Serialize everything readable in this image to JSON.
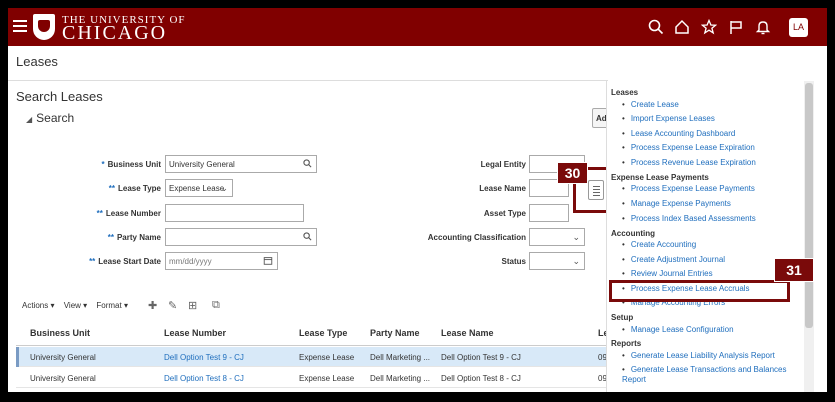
{
  "header": {
    "logo_top": "THE UNIVERSITY OF",
    "logo_main": "CHICAGO",
    "icons": [
      "search-icon",
      "home-icon",
      "star-icon",
      "flag-icon",
      "bell-icon"
    ],
    "avatar": "LA",
    "color": "#800000"
  },
  "page_title": "Leases",
  "search": {
    "title": "Search Leases",
    "toggle_label": "Search",
    "advanced_label": "Ad",
    "fields": {
      "business_unit": {
        "label": "Business Unit",
        "req": "*",
        "value": "University General"
      },
      "lease_type": {
        "label": "Lease Type",
        "req": "**",
        "value": "Expense Lease"
      },
      "lease_number": {
        "label": "Lease Number",
        "req": "**",
        "value": ""
      },
      "party_name": {
        "label": "Party Name",
        "req": "**",
        "value": ""
      },
      "lease_start_date": {
        "label": "Lease Start Date",
        "req": "**",
        "placeholder": "mm/dd/yyyy"
      },
      "legal_entity": {
        "label": "Legal Entity"
      },
      "lease_name": {
        "label": "Lease Name"
      },
      "asset_type": {
        "label": "Asset Type"
      },
      "accounting_classification": {
        "label": "Accounting Classification"
      },
      "status": {
        "label": "Status"
      }
    }
  },
  "toolbar": {
    "actions": "Actions ▾",
    "view": "View ▾",
    "format": "Format ▾"
  },
  "table": {
    "columns": [
      "Business Unit",
      "Lease Number",
      "Lease Type",
      "Party Name",
      "Lease Name",
      "Le"
    ],
    "rows": [
      {
        "bu": "University General",
        "num": "Dell Option Test 9 - CJ",
        "type": "Expense Lease",
        "party": "Dell Marketing ...",
        "name": "Dell Option Test 9 - CJ",
        "le": "09"
      },
      {
        "bu": "University General",
        "num": "Dell Option Test 8 - CJ",
        "type": "Expense Lease",
        "party": "Dell Marketing ...",
        "name": "Dell Option Test 8 - CJ",
        "le": "09"
      }
    ]
  },
  "tasks": {
    "leases": {
      "title": "Leases",
      "items": [
        "Create Lease",
        "Import Expense Leases",
        "Lease Accounting Dashboard",
        "Process Expense Lease Expiration",
        "Process Revenue Lease Expiration"
      ]
    },
    "payments": {
      "title": "Expense Lease Payments",
      "items": [
        "Process Expense Lease Payments",
        "Manage Expense Payments",
        "Process Index Based Assessments"
      ]
    },
    "accounting": {
      "title": "Accounting",
      "items": [
        "Create Accounting",
        "Create Adjustment Journal",
        "Review Journal Entries",
        "Process Expense Lease Accruals",
        "Manage Accounting Errors"
      ]
    },
    "setup": {
      "title": "Setup",
      "items": [
        "Manage Lease Configuration"
      ]
    },
    "reports": {
      "title": "Reports",
      "items": [
        "Generate Lease Liability Analysis Report",
        "Generate Lease Transactions and Balances Report"
      ]
    }
  },
  "callouts": {
    "step30": "30",
    "step31": "31"
  }
}
